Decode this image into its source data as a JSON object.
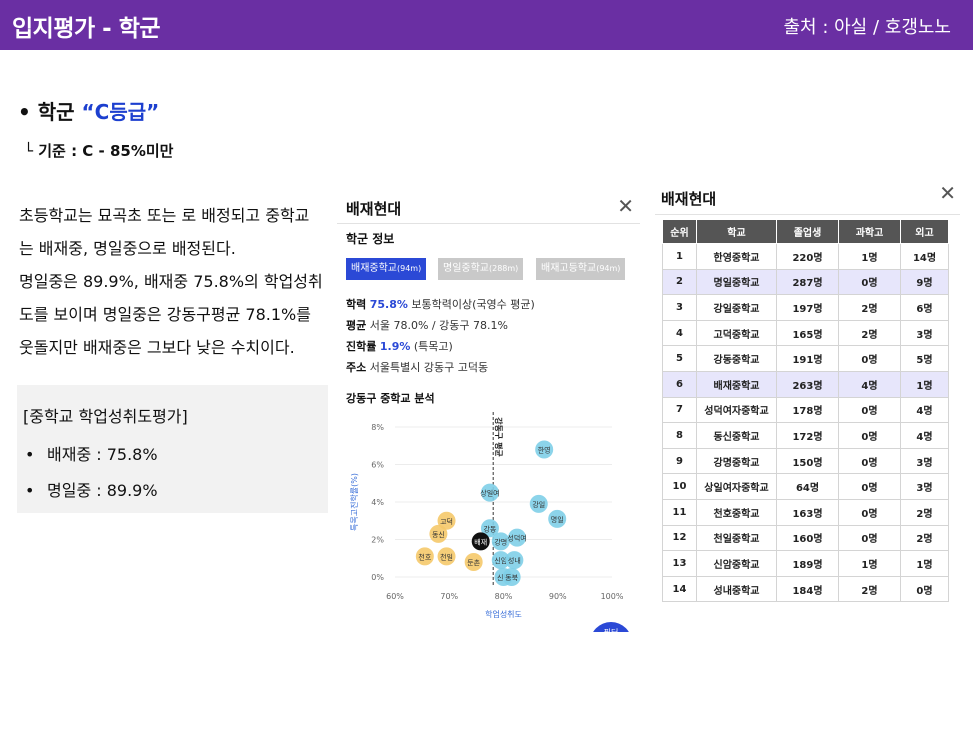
{
  "header": {
    "title": "입지평가 - 학군",
    "source": "출처 : 아실 / 호갱노노"
  },
  "bullet": {
    "prefix": "• 학군 ",
    "grade": "“C등급”"
  },
  "criteria": "└ 기준 : C - 85%미만",
  "paragraph": [
    "초등학교는 묘곡초 또는 로 배정되고 중학교",
    "는 배재중, 명일중으로 배정된다.",
    "명일중은 89.9%, 배재중 75.8%의 학업성취",
    "도를 보이며 명일중은 강동구평균 78.1%를",
    "웃돌지만 배재중은 그보다 낮은 수치이다."
  ],
  "summary": {
    "title": "[중학교 학업성취도평가]",
    "items": [
      {
        "bullet": "•",
        "text": "배재중 : 75.8%"
      },
      {
        "bullet": "•",
        "text": "명일중 : 89.9%"
      }
    ]
  },
  "panel1": {
    "title": "배재현대",
    "close": "✕",
    "subtitle": "학군 정보",
    "tabs": [
      {
        "label": "배재중학교",
        "dist": "(94m)",
        "active": true
      },
      {
        "label": "명일중학교",
        "dist": "(288m)",
        "active": false
      },
      {
        "label": "배재고등학교",
        "dist": "(94m)",
        "active": false
      }
    ],
    "info": [
      {
        "key": "학력",
        "highlight": "75.8%",
        "rest": "보통학력이상(국영수 평균)"
      },
      {
        "key": "평균",
        "highlight": "",
        "rest": "서울 78.0% / 강동구 78.1%"
      },
      {
        "key": "진학률",
        "highlight": "1.9%",
        "rest": "(특목고)"
      },
      {
        "key": "주소",
        "highlight": "",
        "rest": "서울특별시 강동구 고덕동"
      }
    ],
    "chart_title": "강동구 중학교 분석",
    "fab_label": "필터"
  },
  "chart_data": {
    "type": "scatter",
    "xlabel": "학업성취도",
    "ylabel": "특목고진학률(%)",
    "xlim": [
      60,
      100
    ],
    "ylim": [
      0,
      8
    ],
    "xticks": [
      "60%",
      "70%",
      "80%",
      "90%",
      "100%"
    ],
    "yticks": [
      "0%",
      "2%",
      "4%",
      "6%",
      "8%"
    ],
    "avg_line": {
      "x": 78.1,
      "label": "강동구 평균"
    },
    "points": [
      {
        "name": "한영",
        "x": 87.5,
        "y": 6.8,
        "color": "#7fcfe8"
      },
      {
        "name": "상일여",
        "x": 77.5,
        "y": 4.5,
        "color": "#7fcfe8"
      },
      {
        "name": "강일",
        "x": 86.5,
        "y": 3.9,
        "color": "#7fcfe8"
      },
      {
        "name": "명일",
        "x": 89.9,
        "y": 3.1,
        "color": "#7fcfe8"
      },
      {
        "name": "강동",
        "x": 77.5,
        "y": 2.6,
        "color": "#7fcfe8"
      },
      {
        "name": "강명",
        "x": 79.5,
        "y": 1.9,
        "color": "#7fcfe8"
      },
      {
        "name": "성덕여",
        "x": 82.5,
        "y": 2.1,
        "color": "#7fcfe8"
      },
      {
        "name": "신암",
        "x": 79.5,
        "y": 0.9,
        "color": "#7fcfe8"
      },
      {
        "name": "성내",
        "x": 82.0,
        "y": 0.9,
        "color": "#7fcfe8"
      },
      {
        "name": "신명",
        "x": 80.0,
        "y": 0.0,
        "color": "#7fcfe8"
      },
      {
        "name": "동북",
        "x": 81.5,
        "y": 0.0,
        "color": "#7fcfe8"
      },
      {
        "name": "고덕",
        "x": 69.5,
        "y": 3.0,
        "color": "#f5c96a"
      },
      {
        "name": "동신",
        "x": 68.0,
        "y": 2.3,
        "color": "#f5c96a"
      },
      {
        "name": "천호",
        "x": 65.5,
        "y": 1.1,
        "color": "#f5c96a"
      },
      {
        "name": "천일",
        "x": 69.5,
        "y": 1.1,
        "color": "#f5c96a"
      },
      {
        "name": "둔촌",
        "x": 74.5,
        "y": 0.8,
        "color": "#f5c96a"
      },
      {
        "name": "배재",
        "x": 75.8,
        "y": 1.9,
        "color": "#111111"
      }
    ]
  },
  "panel2": {
    "title": "배재현대",
    "close": "✕",
    "columns": [
      "순위",
      "학교",
      "졸업생",
      "과학고",
      "외고"
    ],
    "rows": [
      [
        "1",
        "한영중학교",
        "220명",
        "1명",
        "14명"
      ],
      [
        "2",
        "명일중학교",
        "287명",
        "0명",
        "9명"
      ],
      [
        "3",
        "강일중학교",
        "197명",
        "2명",
        "6명"
      ],
      [
        "4",
        "고덕중학교",
        "165명",
        "2명",
        "3명"
      ],
      [
        "5",
        "강동중학교",
        "191명",
        "0명",
        "5명"
      ],
      [
        "6",
        "배재중학교",
        "263명",
        "4명",
        "1명"
      ],
      [
        "7",
        "성덕여자중학교",
        "178명",
        "0명",
        "4명"
      ],
      [
        "8",
        "동신중학교",
        "172명",
        "0명",
        "4명"
      ],
      [
        "9",
        "강명중학교",
        "150명",
        "0명",
        "3명"
      ],
      [
        "10",
        "상일여자중학교",
        "64명",
        "0명",
        "3명"
      ],
      [
        "11",
        "천호중학교",
        "163명",
        "0명",
        "2명"
      ],
      [
        "12",
        "천일중학교",
        "160명",
        "0명",
        "2명"
      ],
      [
        "13",
        "신암중학교",
        "189명",
        "1명",
        "1명"
      ],
      [
        "14",
        "성내중학교",
        "184명",
        "2명",
        "0명"
      ]
    ],
    "highlight_ranks": [
      "2",
      "6"
    ]
  }
}
